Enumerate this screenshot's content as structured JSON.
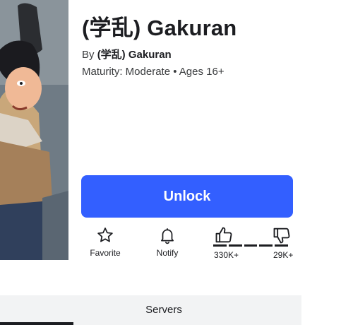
{
  "game": {
    "title": "(学乱) Gakuran",
    "by_prefix": "By",
    "creator": "(学乱) Gakuran",
    "maturity": "Maturity: Moderate • Ages 16+"
  },
  "unlock_label": "Unlock",
  "actions": {
    "favorite": {
      "label": "Favorite",
      "icon": "star-icon"
    },
    "notify": {
      "label": "Notify",
      "icon": "bell-icon"
    }
  },
  "votes": {
    "up_count": "330K+",
    "down_count": "29K+",
    "up_icon": "thumbs-up-icon",
    "down_icon": "thumbs-down-icon"
  },
  "tabs": [
    {
      "label": ""
    },
    {
      "label": "Servers"
    }
  ],
  "colors": {
    "accent": "#335fff",
    "tab_bg": "#f2f3f4",
    "text": "#1c1d21"
  }
}
